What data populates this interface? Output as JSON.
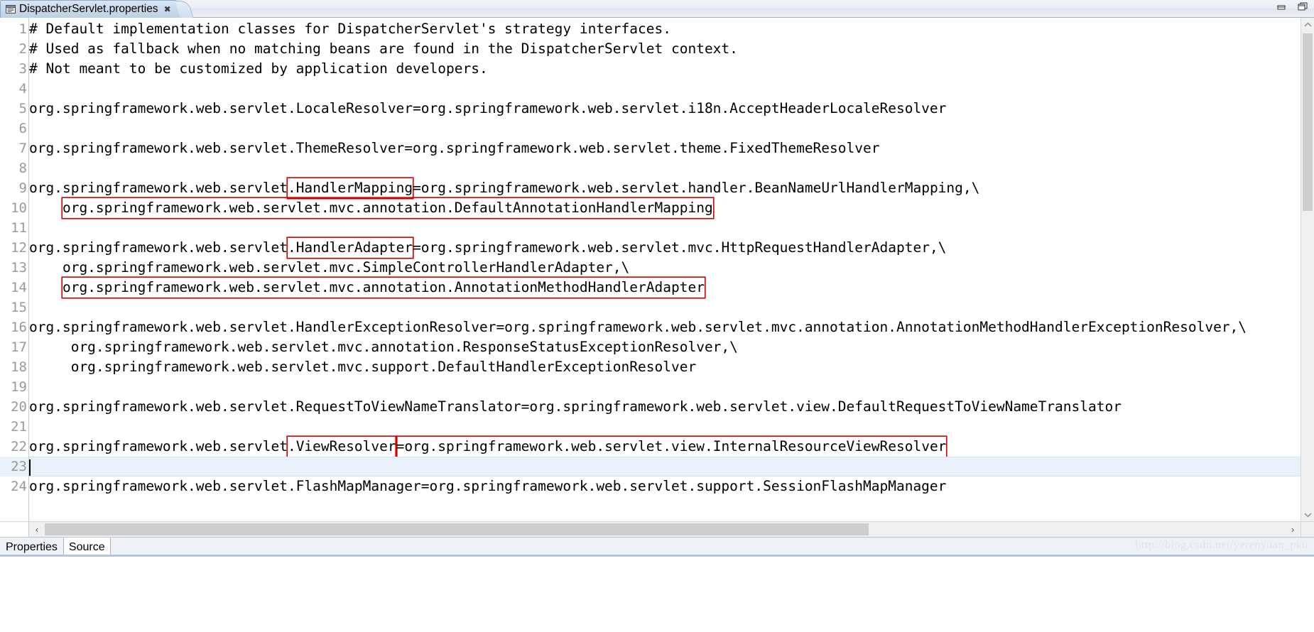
{
  "window": {
    "minimize_label": "Minimize",
    "maximize_label": "Maximize"
  },
  "editor_tab": {
    "title": "DispatcherServlet.properties",
    "close_label": "✖",
    "icon": "properties-file-icon"
  },
  "gutter": {
    "numbers": [
      "1",
      "2",
      "3",
      "4",
      "5",
      "6",
      "7",
      "8",
      "9",
      "10",
      "11",
      "12",
      "13",
      "14",
      "15",
      "16",
      "17",
      "18",
      "19",
      "20",
      "21",
      "22",
      "23",
      "24"
    ],
    "current_line": 23
  },
  "code": {
    "lines": [
      {
        "n": 1,
        "segs": [
          {
            "t": "# Default implementation classes for DispatcherServlet's strategy interfaces.",
            "box": false
          }
        ]
      },
      {
        "n": 2,
        "segs": [
          {
            "t": "# Used as fallback when no matching beans are found in the DispatcherServlet context.",
            "box": false
          }
        ]
      },
      {
        "n": 3,
        "segs": [
          {
            "t": "# Not meant to be customized by application developers.",
            "box": false
          }
        ]
      },
      {
        "n": 4,
        "segs": [
          {
            "t": "",
            "box": false
          }
        ]
      },
      {
        "n": 5,
        "segs": [
          {
            "t": "org.springframework.web.servlet.LocaleResolver=org.springframework.web.servlet.i18n.AcceptHeaderLocaleResolver",
            "box": false
          }
        ]
      },
      {
        "n": 6,
        "segs": [
          {
            "t": "",
            "box": false
          }
        ]
      },
      {
        "n": 7,
        "segs": [
          {
            "t": "org.springframework.web.servlet.ThemeResolver=org.springframework.web.servlet.theme.FixedThemeResolver",
            "box": false
          }
        ]
      },
      {
        "n": 8,
        "segs": [
          {
            "t": "",
            "box": false
          }
        ]
      },
      {
        "n": 9,
        "segs": [
          {
            "t": "org.springframework.web.servlet",
            "box": false
          },
          {
            "t": ".HandlerMapping",
            "box": true
          },
          {
            "t": "=org.springframework.web.servlet.handler.BeanNameUrlHandlerMapping,\\",
            "box": false
          }
        ]
      },
      {
        "n": 10,
        "segs": [
          {
            "t": "    ",
            "box": false
          },
          {
            "t": "org.springframework.web.servlet.mvc.annotation.DefaultAnnotationHandlerMapping",
            "box": true
          }
        ]
      },
      {
        "n": 11,
        "segs": [
          {
            "t": "",
            "box": false
          }
        ]
      },
      {
        "n": 12,
        "segs": [
          {
            "t": "org.springframework.web.servlet",
            "box": false
          },
          {
            "t": ".HandlerAdapter",
            "box": true
          },
          {
            "t": "=org.springframework.web.servlet.mvc.HttpRequestHandlerAdapter,\\",
            "box": false
          }
        ]
      },
      {
        "n": 13,
        "segs": [
          {
            "t": "    org.springframework.web.servlet.mvc.SimpleControllerHandlerAdapter,\\",
            "box": false
          }
        ]
      },
      {
        "n": 14,
        "segs": [
          {
            "t": "    ",
            "box": false
          },
          {
            "t": "org.springframework.web.servlet.mvc.annotation.AnnotationMethodHandlerAdapter",
            "box": true
          }
        ]
      },
      {
        "n": 15,
        "segs": [
          {
            "t": "",
            "box": false
          }
        ]
      },
      {
        "n": 16,
        "segs": [
          {
            "t": "org.springframework.web.servlet.HandlerExceptionResolver=org.springframework.web.servlet.mvc.annotation.AnnotationMethodHandlerExceptionResolver,\\",
            "box": false
          }
        ]
      },
      {
        "n": 17,
        "segs": [
          {
            "t": "     org.springframework.web.servlet.mvc.annotation.ResponseStatusExceptionResolver,\\",
            "box": false
          }
        ]
      },
      {
        "n": 18,
        "segs": [
          {
            "t": "     org.springframework.web.servlet.mvc.support.DefaultHandlerExceptionResolver",
            "box": false
          }
        ]
      },
      {
        "n": 19,
        "segs": [
          {
            "t": "",
            "box": false
          }
        ]
      },
      {
        "n": 20,
        "segs": [
          {
            "t": "org.springframework.web.servlet.RequestToViewNameTranslator=org.springframework.web.servlet.view.DefaultRequestToViewNameTranslator",
            "box": false
          }
        ]
      },
      {
        "n": 21,
        "segs": [
          {
            "t": "",
            "box": false
          }
        ]
      },
      {
        "n": 22,
        "segs": [
          {
            "t": "org.springframework.web.servlet",
            "box": false
          },
          {
            "t": ".ViewResolver",
            "box": true
          },
          {
            "t": "=org.springframework.web.servlet.view.InternalResourceViewResolver",
            "box": true
          }
        ]
      },
      {
        "n": 23,
        "segs": [
          {
            "t": "",
            "box": false
          }
        ]
      },
      {
        "n": 24,
        "segs": [
          {
            "t": "org.springframework.web.servlet.FlashMapManager=org.springframework.web.servlet.support.SessionFlashMapManager",
            "box": false
          }
        ]
      }
    ]
  },
  "scrollbars": {
    "v_up_label": "⌃",
    "v_down_label": "⌄",
    "h_left_label": "‹",
    "h_right_label": "›"
  },
  "bottom_tabs": {
    "items": [
      {
        "label": "Properties",
        "active": false
      },
      {
        "label": "Source",
        "active": true
      }
    ]
  },
  "watermark": {
    "text": "http://blog.csdn.net/yerenyuan_pku"
  },
  "colors": {
    "highlight_box": "#d40000",
    "current_line": "#e8f0fa",
    "gutter_text": "#9a9a9a",
    "tab_active": "#c9d9ec"
  }
}
